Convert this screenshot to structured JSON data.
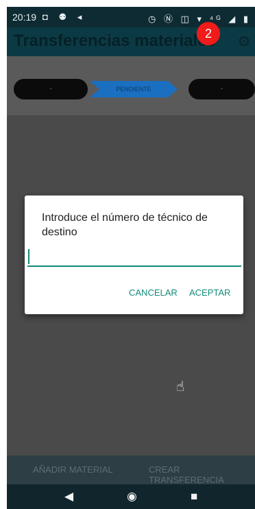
{
  "status_bar": {
    "time": "20:19",
    "left_icons": "◘ ⚉ ◂",
    "right_icons": "◷ Ⓝ ◫ ▾ ⁴ᴳ ◢ ▮"
  },
  "app_bar": {
    "title": "Transferencias materiales",
    "settings_icon": "⚙"
  },
  "badge": "2",
  "stepper": {
    "left_value": "-",
    "current_step": "PENDIENTE",
    "right_value": "-"
  },
  "dialog": {
    "message": "Introduce el número de técnico de destino",
    "input_value": "",
    "cancel_label": "CANCELAR",
    "accept_label": "ACEPTAR"
  },
  "actions": {
    "add_material": "AÑADIR MATERIAL",
    "create_transfer": "CREAR TRANSFERENCIA"
  },
  "nav": {
    "back": "◀",
    "home": "◉",
    "recent": "■"
  },
  "cursor_icon": "☝",
  "colors": {
    "accent": "#138a7a",
    "app_bar": "#0c3a44",
    "badge": "#f01b1b",
    "step_arrow": "#1a6fc0"
  }
}
